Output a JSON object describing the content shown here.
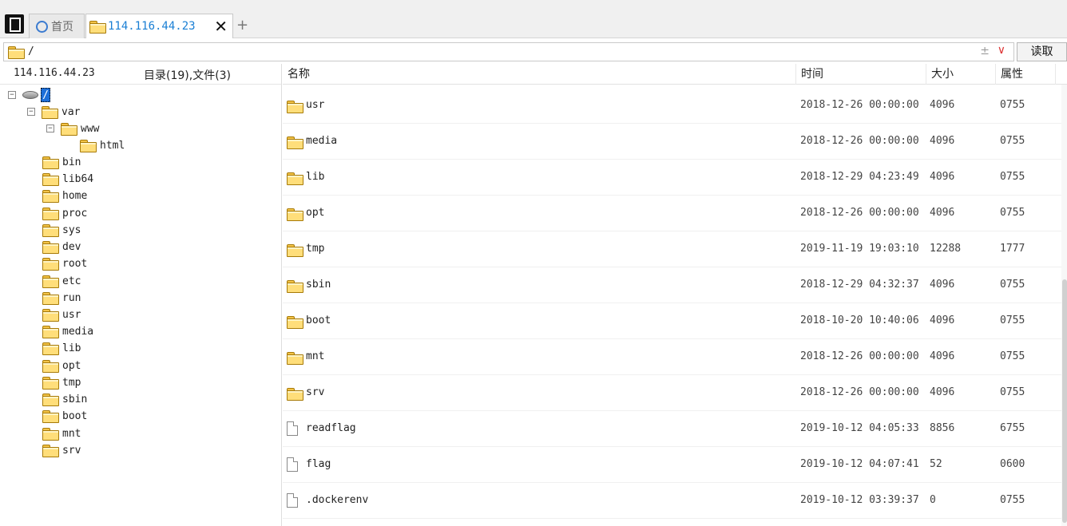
{
  "tabs": {
    "home_label": "首页",
    "active_label": "114.116.44.23",
    "close_symbol": "✕",
    "add_symbol": "+"
  },
  "pathbar": {
    "path": "/",
    "ctrl_symbol": "±",
    "dropdown_symbol": "∨",
    "read_button": "读取"
  },
  "left_panel": {
    "host": "114.116.44.23",
    "counts": "目录(19),文件(3)",
    "root_label": "/",
    "tree": [
      {
        "label": "var",
        "expander": "⊟"
      },
      {
        "label": "www",
        "expander": "⊟"
      },
      {
        "label": "html"
      },
      {
        "label": "bin"
      },
      {
        "label": "lib64"
      },
      {
        "label": "home"
      },
      {
        "label": "proc"
      },
      {
        "label": "sys"
      },
      {
        "label": "dev"
      },
      {
        "label": "root"
      },
      {
        "label": "etc"
      },
      {
        "label": "run"
      },
      {
        "label": "usr"
      },
      {
        "label": "media"
      },
      {
        "label": "lib"
      },
      {
        "label": "opt"
      },
      {
        "label": "tmp"
      },
      {
        "label": "sbin"
      },
      {
        "label": "boot"
      },
      {
        "label": "mnt"
      },
      {
        "label": "srv"
      }
    ]
  },
  "file_list": {
    "columns": [
      "名称",
      "时间",
      "大小",
      "属性"
    ],
    "rows": [
      {
        "name": "usr",
        "time": "2018-12-26 00:00:00",
        "size": "4096",
        "attr": "0755",
        "type": "folder"
      },
      {
        "name": "media",
        "time": "2018-12-26 00:00:00",
        "size": "4096",
        "attr": "0755",
        "type": "folder"
      },
      {
        "name": "lib",
        "time": "2018-12-29 04:23:49",
        "size": "4096",
        "attr": "0755",
        "type": "folder"
      },
      {
        "name": "opt",
        "time": "2018-12-26 00:00:00",
        "size": "4096",
        "attr": "0755",
        "type": "folder"
      },
      {
        "name": "tmp",
        "time": "2019-11-19 19:03:10",
        "size": "12288",
        "attr": "1777",
        "type": "folder"
      },
      {
        "name": "sbin",
        "time": "2018-12-29 04:32:37",
        "size": "4096",
        "attr": "0755",
        "type": "folder"
      },
      {
        "name": "boot",
        "time": "2018-10-20 10:40:06",
        "size": "4096",
        "attr": "0755",
        "type": "folder"
      },
      {
        "name": "mnt",
        "time": "2018-12-26 00:00:00",
        "size": "4096",
        "attr": "0755",
        "type": "folder"
      },
      {
        "name": "srv",
        "time": "2018-12-26 00:00:00",
        "size": "4096",
        "attr": "0755",
        "type": "folder"
      },
      {
        "name": "readflag",
        "time": "2019-10-12 04:05:33",
        "size": "8856",
        "attr": "6755",
        "type": "file"
      },
      {
        "name": "flag",
        "time": "2019-10-12 04:07:41",
        "size": "52",
        "attr": "0600",
        "type": "file"
      },
      {
        "name": ".dockerenv",
        "time": "2019-10-12 03:39:37",
        "size": "0",
        "attr": "0755",
        "type": "file"
      }
    ]
  },
  "colors": {
    "tab_active_text": "#1a7fd4",
    "folder": "#ffde7a",
    "selection": "#1e6fd8",
    "dropdown": "#dd3333"
  }
}
